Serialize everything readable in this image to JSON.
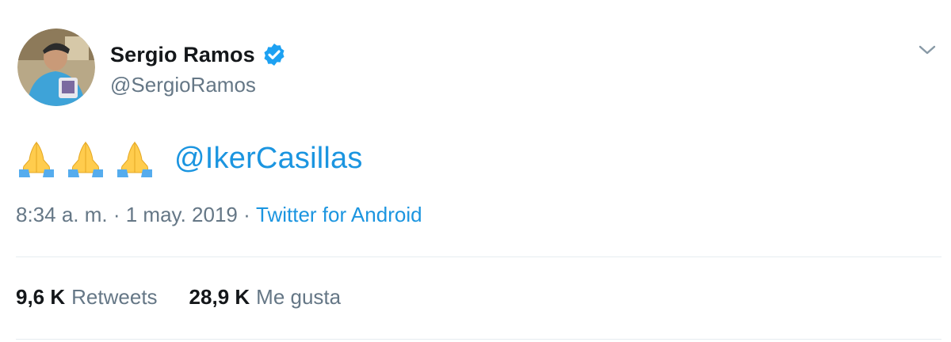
{
  "author": {
    "display_name": "Sergio Ramos",
    "handle": "@SergioRamos",
    "verified": true
  },
  "tweet": {
    "emoji": [
      "🙏",
      "🙏",
      "🙏"
    ],
    "mention": "@IkerCasillas",
    "time": "8:34 a. m.",
    "separator": " · ",
    "date": "1 may. 2019",
    "source": "Twitter for Android"
  },
  "stats": {
    "retweets_count": "9,6 K",
    "retweets_label": "Retweets",
    "likes_count": "28,9 K",
    "likes_label": "Me gusta"
  },
  "colors": {
    "link": "#1b95e0",
    "secondary_text": "#657786",
    "primary_text": "#14171a",
    "verified_badge": "#1da1f2",
    "divider": "#e6ecf0"
  },
  "icons": {
    "verified": "verified-badge-icon",
    "menu": "chevron-down-icon",
    "emoji": "folded-hands-icon"
  }
}
